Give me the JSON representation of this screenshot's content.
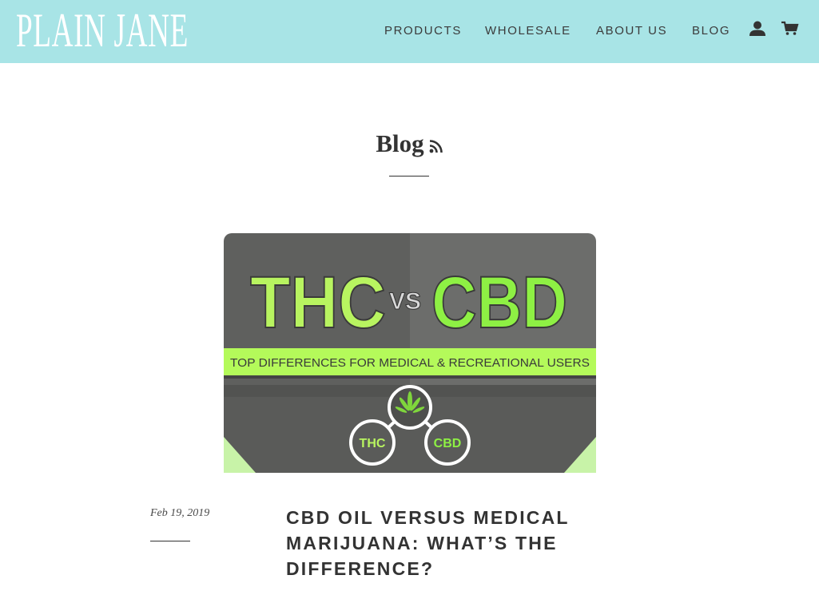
{
  "header": {
    "logo_text": "PLAIN JANE",
    "background": "#a8e4e6",
    "nav": [
      {
        "label": "PRODUCTS"
      },
      {
        "label": "WHOLESALE"
      },
      {
        "label": "ABOUT US"
      },
      {
        "label": "BLOG"
      }
    ],
    "icons": [
      "account-icon",
      "cart-icon"
    ]
  },
  "page": {
    "title": "Blog",
    "title_icon": "rss-icon"
  },
  "featured_image": {
    "left_word": "THC",
    "vs_word": "VS",
    "right_word": "CBD",
    "banner_text": "TOP DIFFERENCES FOR MEDICAL & RECREATIONAL USERS",
    "node_left": "THC",
    "node_right": "CBD",
    "colors": {
      "accent": "#b4fa5a",
      "bright": "#8ef044",
      "dark": "#5e5e5e"
    }
  },
  "article": {
    "date": "Feb 19, 2019",
    "title": "CBD OIL VERSUS MEDICAL MARIJUANA: WHAT’S THE DIFFERENCE?"
  }
}
